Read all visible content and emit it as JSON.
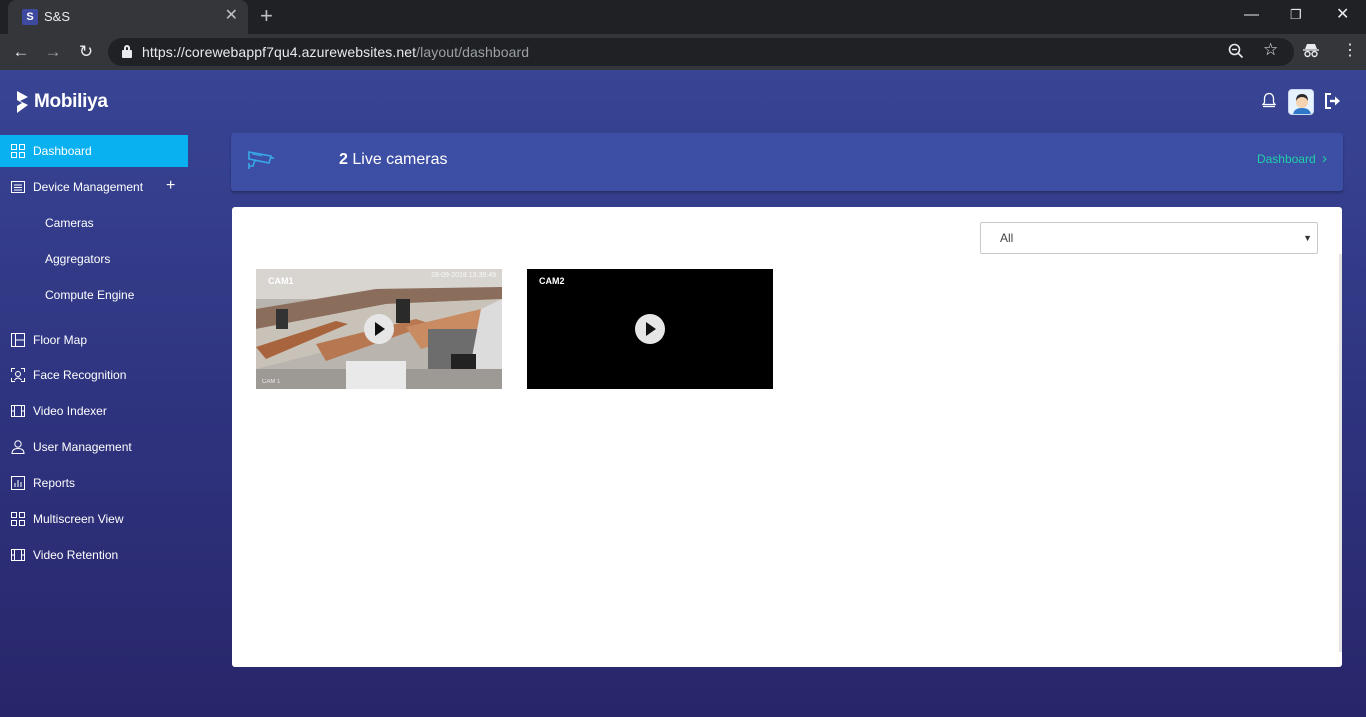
{
  "browser": {
    "tab_title": "S&S",
    "tab_favicon": "S",
    "url_host": "https://corewebappf7qu4.azurewebsites.net",
    "url_path": "/layout/dashboard"
  },
  "app": {
    "brand": "Mobiliya",
    "colors": {
      "sidebar_active": "#0ab1f0",
      "banner_bg": "#3d4ea5",
      "breadcrumb": "#1fd0a7",
      "background_top": "#384594",
      "background_bottom": "#28266a"
    }
  },
  "sidebar": {
    "items": [
      {
        "label": "Dashboard",
        "icon": "grid-icon"
      },
      {
        "label": "Device Management",
        "icon": "list-icon",
        "expand": "+"
      },
      {
        "label": "Cameras"
      },
      {
        "label": "Aggregators"
      },
      {
        "label": "Compute Engine"
      },
      {
        "label": "Floor Map",
        "icon": "floor-map-icon"
      },
      {
        "label": "Face Recognition",
        "icon": "face-scan-icon"
      },
      {
        "label": "Video Indexer",
        "icon": "film-icon"
      },
      {
        "label": "User Management",
        "icon": "user-icon"
      },
      {
        "label": "Reports",
        "icon": "bar-chart-icon"
      },
      {
        "label": "Multiscreen View",
        "icon": "grid-icon"
      },
      {
        "label": "Video Retention",
        "icon": "film-icon"
      }
    ]
  },
  "banner": {
    "count": "2",
    "label": "Live cameras",
    "breadcrumb": "Dashboard",
    "breadcrumb_chevron": "›"
  },
  "filter": {
    "selected": "All"
  },
  "cameras": [
    {
      "name": "CAM1",
      "timestamp": "28-09-2018 13:36:49",
      "overlay_tag": "CAM 1",
      "feed": "office-interior"
    },
    {
      "name": "CAM2",
      "feed": "black"
    }
  ]
}
